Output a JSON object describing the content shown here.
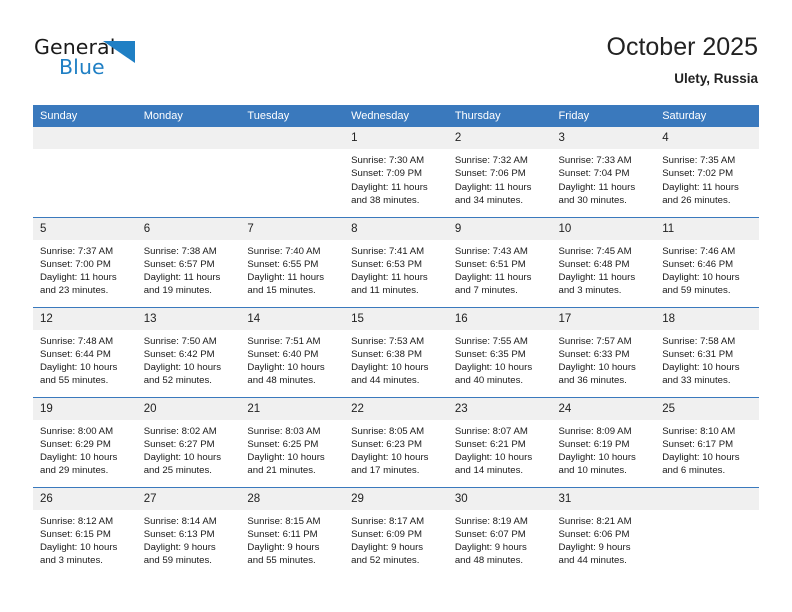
{
  "brand": {
    "word_general": "General",
    "word_blue": "Blue",
    "triangle_color": "#1f7fc4",
    "blue_color": "#1f7fc4"
  },
  "header": {
    "title": "October 2025",
    "subtitle": "Ulety, Russia",
    "accent_color": "#3a79bd",
    "daynum_band_color": "#f0f0f0"
  },
  "weekdays": [
    "Sunday",
    "Monday",
    "Tuesday",
    "Wednesday",
    "Thursday",
    "Friday",
    "Saturday"
  ],
  "weeks": [
    [
      {
        "empty": true,
        "day": ""
      },
      {
        "empty": true,
        "day": ""
      },
      {
        "empty": true,
        "day": ""
      },
      {
        "empty": false,
        "day": "1",
        "sunrise": "Sunrise: 7:30 AM",
        "sunset": "Sunset: 7:09 PM",
        "daylight_line1": "Daylight: 11 hours",
        "daylight_line2": "and 38 minutes."
      },
      {
        "empty": false,
        "day": "2",
        "sunrise": "Sunrise: 7:32 AM",
        "sunset": "Sunset: 7:06 PM",
        "daylight_line1": "Daylight: 11 hours",
        "daylight_line2": "and 34 minutes."
      },
      {
        "empty": false,
        "day": "3",
        "sunrise": "Sunrise: 7:33 AM",
        "sunset": "Sunset: 7:04 PM",
        "daylight_line1": "Daylight: 11 hours",
        "daylight_line2": "and 30 minutes."
      },
      {
        "empty": false,
        "day": "4",
        "sunrise": "Sunrise: 7:35 AM",
        "sunset": "Sunset: 7:02 PM",
        "daylight_line1": "Daylight: 11 hours",
        "daylight_line2": "and 26 minutes."
      }
    ],
    [
      {
        "empty": false,
        "day": "5",
        "sunrise": "Sunrise: 7:37 AM",
        "sunset": "Sunset: 7:00 PM",
        "daylight_line1": "Daylight: 11 hours",
        "daylight_line2": "and 23 minutes."
      },
      {
        "empty": false,
        "day": "6",
        "sunrise": "Sunrise: 7:38 AM",
        "sunset": "Sunset: 6:57 PM",
        "daylight_line1": "Daylight: 11 hours",
        "daylight_line2": "and 19 minutes."
      },
      {
        "empty": false,
        "day": "7",
        "sunrise": "Sunrise: 7:40 AM",
        "sunset": "Sunset: 6:55 PM",
        "daylight_line1": "Daylight: 11 hours",
        "daylight_line2": "and 15 minutes."
      },
      {
        "empty": false,
        "day": "8",
        "sunrise": "Sunrise: 7:41 AM",
        "sunset": "Sunset: 6:53 PM",
        "daylight_line1": "Daylight: 11 hours",
        "daylight_line2": "and 11 minutes."
      },
      {
        "empty": false,
        "day": "9",
        "sunrise": "Sunrise: 7:43 AM",
        "sunset": "Sunset: 6:51 PM",
        "daylight_line1": "Daylight: 11 hours",
        "daylight_line2": "and 7 minutes."
      },
      {
        "empty": false,
        "day": "10",
        "sunrise": "Sunrise: 7:45 AM",
        "sunset": "Sunset: 6:48 PM",
        "daylight_line1": "Daylight: 11 hours",
        "daylight_line2": "and 3 minutes."
      },
      {
        "empty": false,
        "day": "11",
        "sunrise": "Sunrise: 7:46 AM",
        "sunset": "Sunset: 6:46 PM",
        "daylight_line1": "Daylight: 10 hours",
        "daylight_line2": "and 59 minutes."
      }
    ],
    [
      {
        "empty": false,
        "day": "12",
        "sunrise": "Sunrise: 7:48 AM",
        "sunset": "Sunset: 6:44 PM",
        "daylight_line1": "Daylight: 10 hours",
        "daylight_line2": "and 55 minutes."
      },
      {
        "empty": false,
        "day": "13",
        "sunrise": "Sunrise: 7:50 AM",
        "sunset": "Sunset: 6:42 PM",
        "daylight_line1": "Daylight: 10 hours",
        "daylight_line2": "and 52 minutes."
      },
      {
        "empty": false,
        "day": "14",
        "sunrise": "Sunrise: 7:51 AM",
        "sunset": "Sunset: 6:40 PM",
        "daylight_line1": "Daylight: 10 hours",
        "daylight_line2": "and 48 minutes."
      },
      {
        "empty": false,
        "day": "15",
        "sunrise": "Sunrise: 7:53 AM",
        "sunset": "Sunset: 6:38 PM",
        "daylight_line1": "Daylight: 10 hours",
        "daylight_line2": "and 44 minutes."
      },
      {
        "empty": false,
        "day": "16",
        "sunrise": "Sunrise: 7:55 AM",
        "sunset": "Sunset: 6:35 PM",
        "daylight_line1": "Daylight: 10 hours",
        "daylight_line2": "and 40 minutes."
      },
      {
        "empty": false,
        "day": "17",
        "sunrise": "Sunrise: 7:57 AM",
        "sunset": "Sunset: 6:33 PM",
        "daylight_line1": "Daylight: 10 hours",
        "daylight_line2": "and 36 minutes."
      },
      {
        "empty": false,
        "day": "18",
        "sunrise": "Sunrise: 7:58 AM",
        "sunset": "Sunset: 6:31 PM",
        "daylight_line1": "Daylight: 10 hours",
        "daylight_line2": "and 33 minutes."
      }
    ],
    [
      {
        "empty": false,
        "day": "19",
        "sunrise": "Sunrise: 8:00 AM",
        "sunset": "Sunset: 6:29 PM",
        "daylight_line1": "Daylight: 10 hours",
        "daylight_line2": "and 29 minutes."
      },
      {
        "empty": false,
        "day": "20",
        "sunrise": "Sunrise: 8:02 AM",
        "sunset": "Sunset: 6:27 PM",
        "daylight_line1": "Daylight: 10 hours",
        "daylight_line2": "and 25 minutes."
      },
      {
        "empty": false,
        "day": "21",
        "sunrise": "Sunrise: 8:03 AM",
        "sunset": "Sunset: 6:25 PM",
        "daylight_line1": "Daylight: 10 hours",
        "daylight_line2": "and 21 minutes."
      },
      {
        "empty": false,
        "day": "22",
        "sunrise": "Sunrise: 8:05 AM",
        "sunset": "Sunset: 6:23 PM",
        "daylight_line1": "Daylight: 10 hours",
        "daylight_line2": "and 17 minutes."
      },
      {
        "empty": false,
        "day": "23",
        "sunrise": "Sunrise: 8:07 AM",
        "sunset": "Sunset: 6:21 PM",
        "daylight_line1": "Daylight: 10 hours",
        "daylight_line2": "and 14 minutes."
      },
      {
        "empty": false,
        "day": "24",
        "sunrise": "Sunrise: 8:09 AM",
        "sunset": "Sunset: 6:19 PM",
        "daylight_line1": "Daylight: 10 hours",
        "daylight_line2": "and 10 minutes."
      },
      {
        "empty": false,
        "day": "25",
        "sunrise": "Sunrise: 8:10 AM",
        "sunset": "Sunset: 6:17 PM",
        "daylight_line1": "Daylight: 10 hours",
        "daylight_line2": "and 6 minutes."
      }
    ],
    [
      {
        "empty": false,
        "day": "26",
        "sunrise": "Sunrise: 8:12 AM",
        "sunset": "Sunset: 6:15 PM",
        "daylight_line1": "Daylight: 10 hours",
        "daylight_line2": "and 3 minutes."
      },
      {
        "empty": false,
        "day": "27",
        "sunrise": "Sunrise: 8:14 AM",
        "sunset": "Sunset: 6:13 PM",
        "daylight_line1": "Daylight: 9 hours",
        "daylight_line2": "and 59 minutes."
      },
      {
        "empty": false,
        "day": "28",
        "sunrise": "Sunrise: 8:15 AM",
        "sunset": "Sunset: 6:11 PM",
        "daylight_line1": "Daylight: 9 hours",
        "daylight_line2": "and 55 minutes."
      },
      {
        "empty": false,
        "day": "29",
        "sunrise": "Sunrise: 8:17 AM",
        "sunset": "Sunset: 6:09 PM",
        "daylight_line1": "Daylight: 9 hours",
        "daylight_line2": "and 52 minutes."
      },
      {
        "empty": false,
        "day": "30",
        "sunrise": "Sunrise: 8:19 AM",
        "sunset": "Sunset: 6:07 PM",
        "daylight_line1": "Daylight: 9 hours",
        "daylight_line2": "and 48 minutes."
      },
      {
        "empty": false,
        "day": "31",
        "sunrise": "Sunrise: 8:21 AM",
        "sunset": "Sunset: 6:06 PM",
        "daylight_line1": "Daylight: 9 hours",
        "daylight_line2": "and 44 minutes."
      },
      {
        "empty": true,
        "day": ""
      }
    ]
  ]
}
